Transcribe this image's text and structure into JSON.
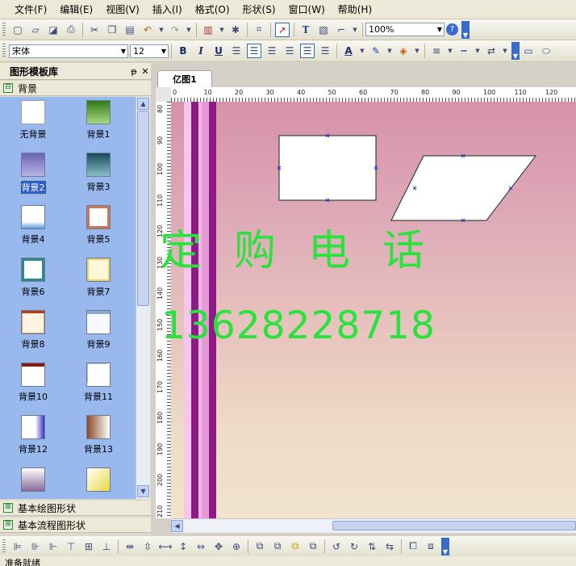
{
  "menu": [
    "文件(F)",
    "编辑(E)",
    "视图(V)",
    "插入(I)",
    "格式(O)",
    "形状(S)",
    "窗口(W)",
    "帮助(H)"
  ],
  "toolbar1": {
    "zoom": "100%"
  },
  "toolbar2": {
    "font": "宋体",
    "size": "12",
    "bold": "B",
    "italic": "I",
    "underline": "U",
    "text_tool": "T",
    "font_color_glyph": "A"
  },
  "panel": {
    "title": "图形模板库",
    "pin": "ᵽ",
    "close": "✕",
    "active_category": "背景",
    "categories_below": [
      "基本绘图形状",
      "基本流程图形状"
    ],
    "items": [
      {
        "label": "无背景",
        "selected": false
      },
      {
        "label": "背景1",
        "selected": false
      },
      {
        "label": "背景2",
        "selected": true
      },
      {
        "label": "背景3",
        "selected": false
      },
      {
        "label": "背景4",
        "selected": false
      },
      {
        "label": "背景5",
        "selected": false
      },
      {
        "label": "背景6",
        "selected": false
      },
      {
        "label": "背景7",
        "selected": false
      },
      {
        "label": "背景8",
        "selected": false
      },
      {
        "label": "背景9",
        "selected": false
      },
      {
        "label": "背景10",
        "selected": false
      },
      {
        "label": "背景11",
        "selected": false
      },
      {
        "label": "背景12",
        "selected": false
      },
      {
        "label": "背景13",
        "selected": false
      },
      {
        "label": "",
        "selected": false
      },
      {
        "label": "",
        "selected": false
      }
    ]
  },
  "document": {
    "tab": "亿图1",
    "ruler_top": [
      "0",
      "10",
      "20",
      "30",
      "40",
      "50",
      "60",
      "70",
      "80",
      "90",
      "100",
      "110",
      "120"
    ],
    "ruler_left": [
      "80",
      "90",
      "100",
      "110",
      "120",
      "130",
      "140",
      "150",
      "160",
      "170",
      "180",
      "190",
      "200",
      "210"
    ]
  },
  "overlay": {
    "line1": "定购电话",
    "line2": "13628228718"
  },
  "status": "准备就绪",
  "colors": {
    "overlay": "#28e33c",
    "panel_bg": "#98b8ee",
    "selection": "#2f5fc4"
  }
}
